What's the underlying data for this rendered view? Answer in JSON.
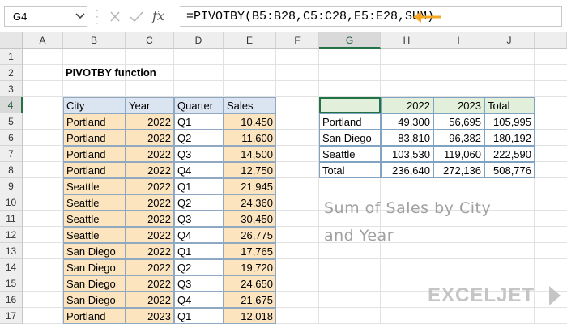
{
  "formula_bar": {
    "name_box": "G4",
    "formula": "=PIVOTBY(B5:B28,C5:C28,E5:E28,SUM)",
    "fx_label": "fx"
  },
  "columns": [
    "A",
    "B",
    "C",
    "D",
    "E",
    "F",
    "G",
    "H",
    "I",
    "J"
  ],
  "rows": [
    "1",
    "2",
    "3",
    "4",
    "5",
    "6",
    "7",
    "8",
    "9",
    "10",
    "11",
    "12",
    "13",
    "14",
    "15",
    "16",
    "17"
  ],
  "selected_cell": {
    "column": "G",
    "row": "4"
  },
  "sheet_title": "PIVOTBY function",
  "source_table": {
    "headers": [
      "City",
      "Year",
      "Quarter",
      "Sales"
    ],
    "rows": [
      [
        "Portland",
        "2022",
        "Q1",
        "10,450"
      ],
      [
        "Portland",
        "2022",
        "Q2",
        "11,600"
      ],
      [
        "Portland",
        "2022",
        "Q3",
        "14,500"
      ],
      [
        "Portland",
        "2022",
        "Q4",
        "12,750"
      ],
      [
        "Seattle",
        "2022",
        "Q1",
        "21,945"
      ],
      [
        "Seattle",
        "2022",
        "Q2",
        "24,360"
      ],
      [
        "Seattle",
        "2022",
        "Q3",
        "30,450"
      ],
      [
        "Seattle",
        "2022",
        "Q4",
        "26,775"
      ],
      [
        "San Diego",
        "2022",
        "Q1",
        "17,765"
      ],
      [
        "San Diego",
        "2022",
        "Q2",
        "19,720"
      ],
      [
        "San Diego",
        "2022",
        "Q3",
        "24,650"
      ],
      [
        "San Diego",
        "2022",
        "Q4",
        "21,675"
      ],
      [
        "Portland",
        "2023",
        "Q1",
        "12,018"
      ]
    ],
    "colors": {
      "header": "#dbe4f1",
      "highlight": "#fce4bf",
      "border": "#8ea9c1"
    }
  },
  "pivot_table": {
    "headers": [
      "",
      "2022",
      "2023",
      "Total"
    ],
    "rows": [
      [
        "Portland",
        "49,300",
        "56,695",
        "105,995"
      ],
      [
        "San Diego",
        "83,810",
        "96,382",
        "180,192"
      ],
      [
        "Seattle",
        "103,530",
        "119,060",
        "222,590"
      ],
      [
        "Total",
        "236,640",
        "272,136",
        "508,776"
      ]
    ],
    "colors": {
      "header": "#e2efda",
      "border": "#7fa3c1"
    }
  },
  "annotation": {
    "line1": "Sum of Sales by City",
    "line2": "and Year"
  },
  "watermark": {
    "text": "EXCELJET",
    "color": "#c5c5c5"
  },
  "accent_colors": {
    "selection": "#217346",
    "arrow": "#f5a623"
  }
}
